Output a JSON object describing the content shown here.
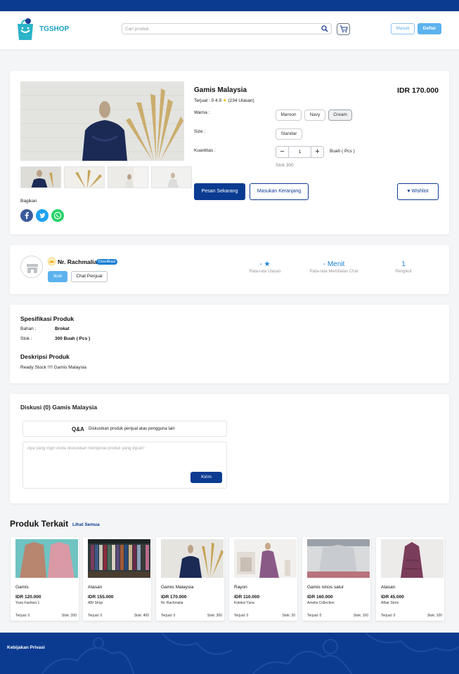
{
  "header": {
    "brand": "TGSHOP",
    "search_placeholder": "Cari produk",
    "login_label": "Masuk",
    "register_label": "Daftar"
  },
  "product": {
    "title": "Gamis Malaysia",
    "price": "IDR 170.000",
    "stats": "Terjual : 0  4.9",
    "reviews": "(234 Ulasan)",
    "color_label": "Warna :",
    "colors": [
      "Maroon",
      "Navy",
      "Cream"
    ],
    "size_label": "Size :",
    "sizes": [
      "Standar"
    ],
    "qty_label": "Kuantitas :",
    "qty_value": "1",
    "unit": "Buah ( Pcs )",
    "stock": "Stok 300",
    "order_label": "Pesan Sekarang",
    "cart_label": "Masukan Keranjang",
    "wishlist_label": "Wishlist",
    "share_label": "Bagikan"
  },
  "seller": {
    "name": "Nr. Rachmalia",
    "badge": "Diverifikasi",
    "follow_label": "Ikuti",
    "chat_label": "Chat Penjual",
    "stats": [
      {
        "value": "- ★",
        "label": "Rata-rata Ulasan"
      },
      {
        "value": "- Menit",
        "label": "Rata-rata Membalas Chat"
      },
      {
        "value": "1",
        "label": "Pengikut"
      }
    ]
  },
  "specs": {
    "title": "Spesifikasi Produk",
    "rows": [
      {
        "label": "Bahan :",
        "value": "Brokat"
      },
      {
        "label": "Stok :",
        "value": "300 Buah ( Pcs )"
      }
    ],
    "desc_title": "Deskripsi Produk",
    "desc": "Ready Stock !!!! Gamis Malaysia"
  },
  "discussion": {
    "title": "Diskusi (0)   Gamis Malaysia",
    "qa_label": "Q&A",
    "qa_desc": "Diskusikan produk penjual atau pengguna lain",
    "placeholder": "Apa yang ingin Anda diskusikan mengenai produk yang dijual?",
    "send_label": "Kirim"
  },
  "related": {
    "title": "Produk Terkait",
    "see_all": "Lihat Semua",
    "items": [
      {
        "name": "Gamis",
        "price": "IDR 120.000",
        "shop": "Yoza Fashion 1",
        "sold": "Terjual: 0",
        "stock": "Stok: 200"
      },
      {
        "name": "Atasan",
        "price": "IDR 155.000",
        "shop": "ABI Shop",
        "sold": "Terjual: 0",
        "stock": "Stok: 400"
      },
      {
        "name": "Gamis Malaysia",
        "price": "IDR 170.000",
        "shop": "Nr. Rachmalia",
        "sold": "Terjual: 0",
        "stock": "Stok: 300"
      },
      {
        "name": "Rayon",
        "price": "IDR 110.000",
        "shop": "Koleksi Yuna",
        "sold": "Terjual: 0",
        "stock": "Stok: 20"
      },
      {
        "name": "Gamis ninos salur",
        "price": "IDR 160.000",
        "shop": "Amelia Collection",
        "sold": "Terjual: 0",
        "stock": "Stok: 100"
      },
      {
        "name": "Atasan",
        "price": "IDR 45.000",
        "shop": "Athar Store",
        "sold": "Terjual: 0",
        "stock": "Stok: 100"
      }
    ]
  },
  "footer": {
    "privacy": "Kebijakan Privasi"
  },
  "colors": {
    "primary": "#0b3b91",
    "accent": "#5bb2ee",
    "link_blue": "#1a7fd4"
  }
}
